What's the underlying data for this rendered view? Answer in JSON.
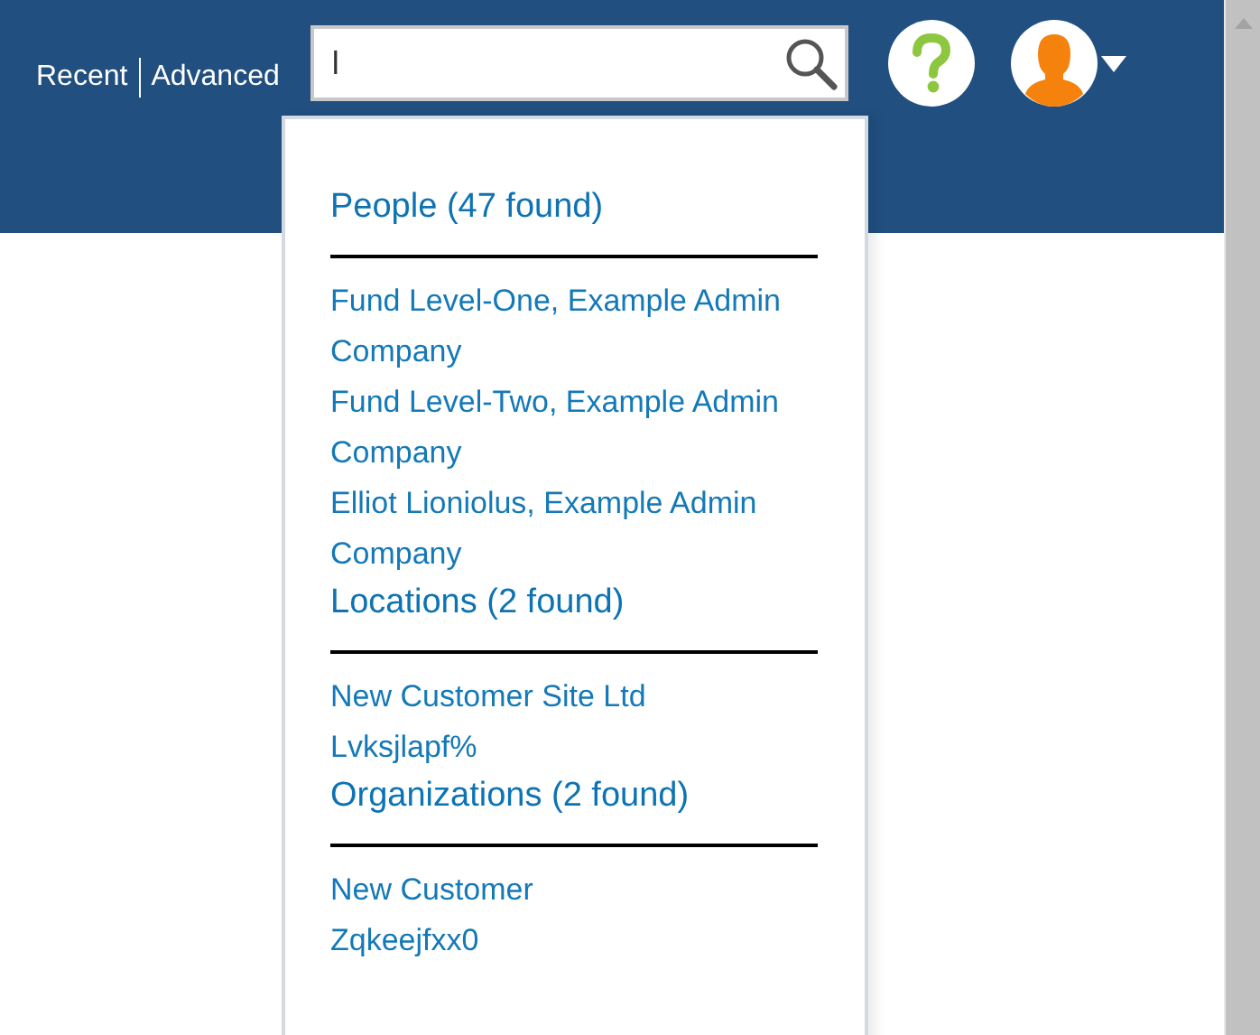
{
  "nav_links": [
    {
      "label": "Recent"
    },
    {
      "label": "Advanced"
    }
  ],
  "search": {
    "value": "l"
  },
  "results": [
    {
      "heading": "People (47 found)",
      "items": [
        "Fund Level-One, Example Admin Company",
        "Fund Level-Two, Example Admin Company",
        "Elliot Lioniolus, Example Admin Company"
      ]
    },
    {
      "heading": "Locations (2 found)",
      "items": [
        "New Customer Site Ltd",
        "Lvksjlapf%"
      ]
    },
    {
      "heading": "Organizations (2 found)",
      "items": [
        "New Customer",
        "Zqkeejfxx0"
      ]
    }
  ]
}
